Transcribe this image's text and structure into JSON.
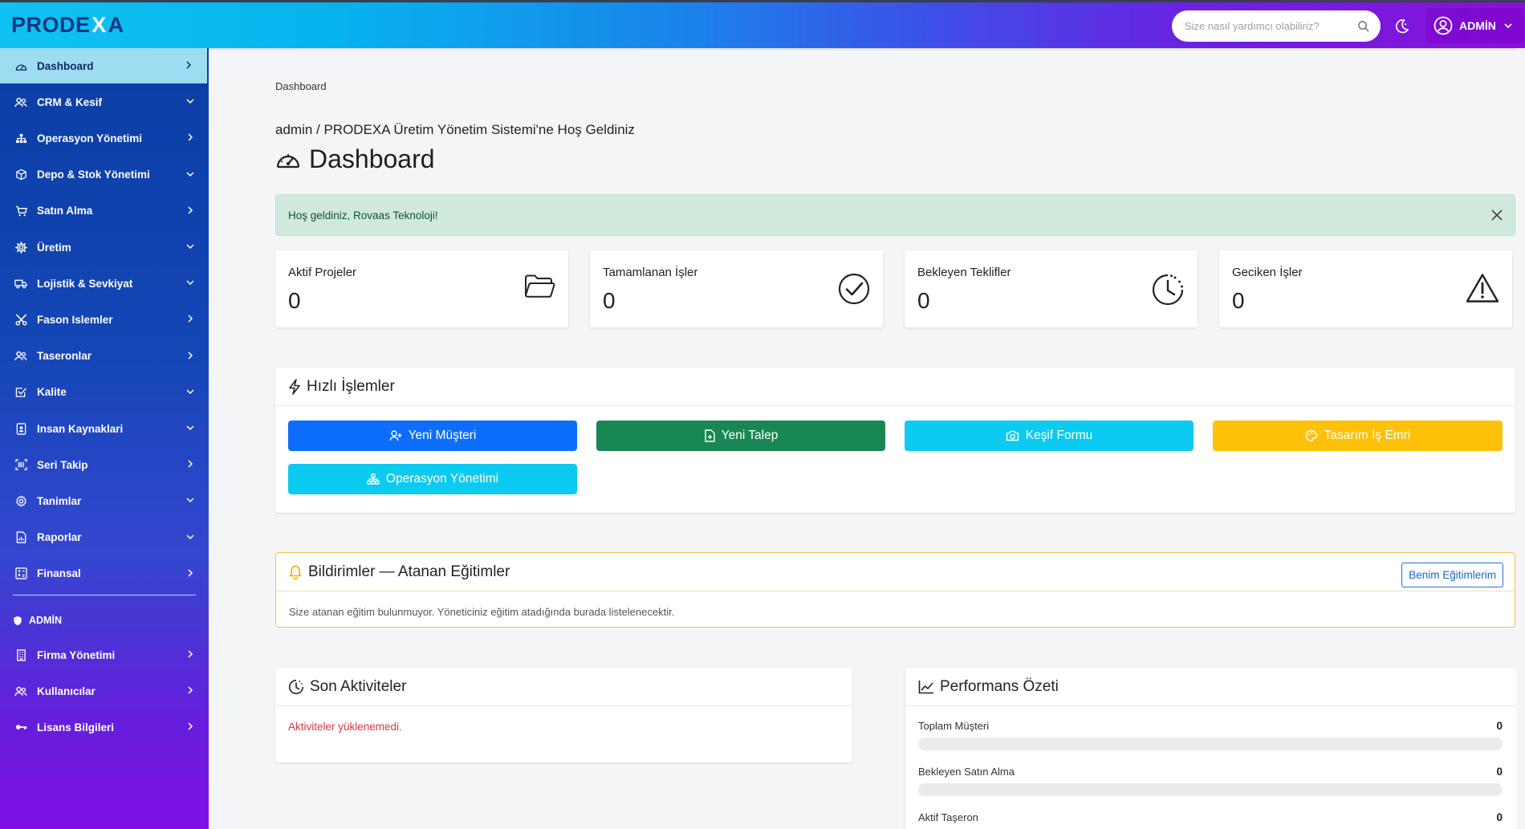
{
  "app": {
    "logo_text": "PRODE",
    "logo_x": "X",
    "logo_tail": "A"
  },
  "header": {
    "search_placeholder": "Size nasıl yardımcı olabiliriz?",
    "user_label": "ADMİN"
  },
  "sidebar": {
    "items": [
      {
        "label": "Dashboard",
        "icon": "dashboard-icon",
        "chevron": "right",
        "active": true
      },
      {
        "label": "CRM & Kesif",
        "icon": "users-icon",
        "chevron": "down"
      },
      {
        "label": "Operasyon Yönetimi",
        "icon": "sitemap-icon",
        "chevron": "right"
      },
      {
        "label": "Depo & Stok Yönetimi",
        "icon": "box-icon",
        "chevron": "down"
      },
      {
        "label": "Satın Alma",
        "icon": "cart-icon",
        "chevron": "right"
      },
      {
        "label": "Üretim",
        "icon": "gear-icon",
        "chevron": "down"
      },
      {
        "label": "Lojistik & Sevkiyat",
        "icon": "truck-icon",
        "chevron": "down"
      },
      {
        "label": "Fason Islemler",
        "icon": "scissors-icon",
        "chevron": "right"
      },
      {
        "label": "Taseronlar",
        "icon": "users-icon",
        "chevron": "right"
      },
      {
        "label": "Kalite",
        "icon": "check-square-icon",
        "chevron": "down"
      },
      {
        "label": "Insan Kaynaklari",
        "icon": "id-badge-icon",
        "chevron": "down"
      },
      {
        "label": "Seri Takip",
        "icon": "barcode-icon",
        "chevron": "right"
      },
      {
        "label": "Tanimlar",
        "icon": "settings-icon",
        "chevron": "down"
      },
      {
        "label": "Raporlar",
        "icon": "report-icon",
        "chevron": "down"
      },
      {
        "label": "Finansal",
        "icon": "finance-icon",
        "chevron": "right"
      }
    ],
    "section_label": "ADMİN",
    "admin_items": [
      {
        "label": "Firma Yönetimi",
        "icon": "building-icon",
        "chevron": "right"
      },
      {
        "label": "Kullanıcılar",
        "icon": "users-icon",
        "chevron": "right"
      },
      {
        "label": "Lisans Bilgileri",
        "icon": "key-icon",
        "chevron": "right"
      }
    ]
  },
  "main": {
    "breadcrumb": "Dashboard",
    "welcome": "admin / PRODEXA Üretim Yönetim Sistemi'ne Hoş Geldiniz",
    "title": "Dashboard",
    "alert": "Hoş geldiniz, Rovaas Teknoloji!",
    "stats": [
      {
        "title": "Aktif Projeler",
        "value": "0",
        "icon": "folder-icon"
      },
      {
        "title": "Tamamlanan İşler",
        "value": "0",
        "icon": "check-circle-icon"
      },
      {
        "title": "Bekleyen Teklifler",
        "value": "0",
        "icon": "clock-icon"
      },
      {
        "title": "Geciken İşler",
        "value": "0",
        "icon": "warning-icon"
      }
    ],
    "quick": {
      "title": "Hızlı İşlemler",
      "buttons": [
        {
          "label": "Yeni Müşteri",
          "color": "#0d6efd",
          "icon": "user-plus-icon"
        },
        {
          "label": "Yeni Talep",
          "color": "#198754",
          "icon": "file-plus-icon"
        },
        {
          "label": "Keşif Formu",
          "color": "#0dcaf0",
          "icon": "camera-icon"
        },
        {
          "label": "Tasarım İş Emri",
          "color": "#ffc107",
          "icon": "palette-icon"
        },
        {
          "label": "Operasyon Yönetimi",
          "color": "#0dcaf0",
          "icon": "sitemap-icon"
        }
      ]
    },
    "notifications": {
      "title": "Bildirimler — Atanan Eğitimler",
      "button": "Benim Eğitimlerim",
      "empty": "Size atanan eğitim bulunmuyor. Yöneticiniz eğitim atadığında burada listelenecektir."
    },
    "activities": {
      "title": "Son Aktiviteler",
      "error": "Aktiviteler yüklenemedi."
    },
    "performance": {
      "title": "Performans Özeti",
      "rows": [
        {
          "label": "Toplam Müşteri",
          "value": "0",
          "progress": 0
        },
        {
          "label": "Bekleyen Satın Alma",
          "value": "0",
          "progress": 0
        },
        {
          "label": "Aktif Taşeron",
          "value": "0",
          "progress": 0
        }
      ]
    }
  }
}
